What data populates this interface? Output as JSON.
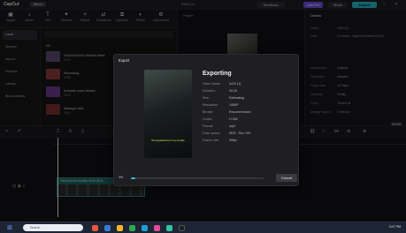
{
  "titlebar": {
    "logo": "CapCut",
    "menu": "Menu",
    "title": "0410 (1)",
    "share": "Shortcuts",
    "pro": "Join Pro",
    "mode": "Mode",
    "export": "Export",
    "win_min": "–",
    "win_close": "✕"
  },
  "tools": [
    {
      "icon": "▣",
      "label": "Import"
    },
    {
      "icon": "♪",
      "label": "Audio"
    },
    {
      "icon": "T",
      "label": "Text"
    },
    {
      "icon": "✦",
      "label": "Stickers"
    },
    {
      "icon": "✧",
      "label": "Effects"
    },
    {
      "icon": "⇄",
      "label": "Transitions"
    },
    {
      "icon": "⧉",
      "label": "Captions"
    },
    {
      "icon": "◐",
      "label": "Filters"
    },
    {
      "icon": "⚙",
      "label": "Adjustment"
    }
  ],
  "sidebar": {
    "items": [
      {
        "label": "Local",
        "active": true
      },
      {
        "label": "Spaces"
      },
      {
        "label": "Import"
      },
      {
        "label": "Projects"
      },
      {
        "label": "Library"
      },
      {
        "label": "Brand assets"
      }
    ]
  },
  "media": {
    "tag": "All",
    "rows": [
      {
        "name": "VID20240410 ###### ####",
        "sub": "00:12",
        "color": "#5a4a72"
      },
      {
        "name": "Recording",
        "sub": "00:08",
        "color": "#8a3b3b"
      },
      {
        "name": "Animate wave #####",
        "sub": "00:05",
        "color": "#6a3a8a"
      },
      {
        "name": "Manager ###",
        "sub": "00:04",
        "color": "#7a2f2f"
      }
    ]
  },
  "player": {
    "label": "Player"
  },
  "details": {
    "tab": "Details",
    "rows": [
      {
        "k": "Name:",
        "v": "0410 (1)"
      },
      {
        "k": "Path:",
        "v": "C:/Users/.../CapCut Drafts/0410 (1)"
      },
      {
        "k": "Aspect ratio:",
        "v": "Original"
      },
      {
        "k": "Resolution:",
        "v": "Adapted"
      },
      {
        "k": "Frame rate:",
        "v": "30.00fps"
      },
      {
        "k": "Imported:",
        "v": "Modify"
      },
      {
        "k": "Proxy:",
        "v": "Turned off"
      },
      {
        "k": "Arrange layers:",
        "v": "Turned on"
      }
    ],
    "modify": "Modify"
  },
  "modal": {
    "title": "Export",
    "heading": "Exporting",
    "caption": "the keyboard is in my hands",
    "rows": [
      {
        "k": "Video Name:",
        "v": "0410 (1)"
      },
      {
        "k": "Duration:",
        "v": "00:25"
      },
      {
        "k": "Size:",
        "v": "Estimating"
      },
      {
        "k": "Resolution:",
        "v": "1080P"
      },
      {
        "k": "Bit rate:",
        "v": "Recommended"
      },
      {
        "k": "Codec:",
        "v": "H.264"
      },
      {
        "k": "Format:",
        "v": "mp4"
      },
      {
        "k": "Color space:",
        "v": "SDR - Rec.709"
      },
      {
        "k": "Frame rate:",
        "v": "30fps"
      }
    ],
    "progress_pct": "3%",
    "progress_value": 0.03,
    "cancel": "Cancel"
  },
  "timeline": {
    "clip_title": "VID20240410 ###### 00:00:25:01",
    "cover": "Cover"
  },
  "taskbar": {
    "search": "Search",
    "clock": "3:07 PM"
  },
  "colors": {
    "accent": "#27b7c6",
    "pro": "#6c4ee0"
  }
}
